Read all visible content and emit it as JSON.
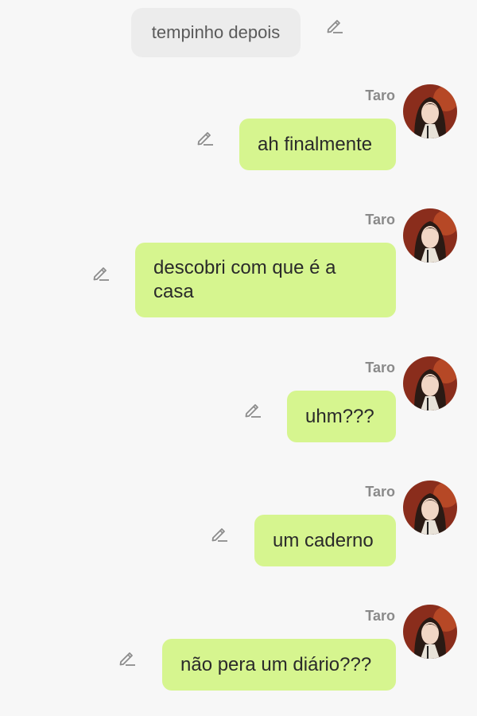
{
  "narration": {
    "text": "tempinho depois"
  },
  "messages": [
    {
      "sender": "Taro",
      "text": "ah finalmente"
    },
    {
      "sender": "Taro",
      "text": "descobri com que é a casa"
    },
    {
      "sender": "Taro",
      "text": "uhm???"
    },
    {
      "sender": "Taro",
      "text": "um caderno"
    },
    {
      "sender": "Taro",
      "text": "não pera um diário???"
    }
  ],
  "icons": {
    "edit": "pencil-edit-icon",
    "avatar": "character-avatar"
  },
  "colors": {
    "background": "#f7f7f7",
    "user_bubble": "#d6f58f",
    "narration_bubble": "#ececec",
    "name_text": "#8a8a8a"
  }
}
